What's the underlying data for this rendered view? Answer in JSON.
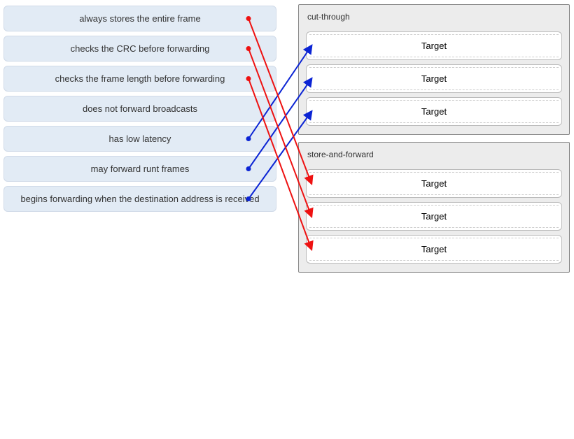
{
  "sources": [
    {
      "id": "src0",
      "label": "always stores the entire frame"
    },
    {
      "id": "src1",
      "label": "checks the CRC before forwarding"
    },
    {
      "id": "src2",
      "label": "checks the frame length before forwarding"
    },
    {
      "id": "src3",
      "label": "does not forward broadcasts"
    },
    {
      "id": "src4",
      "label": "has low latency"
    },
    {
      "id": "src5",
      "label": "may forward runt frames"
    },
    {
      "id": "src6",
      "label": "begins forwarding when the destination address is received"
    }
  ],
  "groups": [
    {
      "id": "grp0",
      "title": "cut-through",
      "targets": [
        {
          "id": "t0",
          "label": "Target"
        },
        {
          "id": "t1",
          "label": "Target"
        },
        {
          "id": "t2",
          "label": "Target"
        }
      ]
    },
    {
      "id": "grp1",
      "title": "store-and-forward",
      "targets": [
        {
          "id": "t3",
          "label": "Target"
        },
        {
          "id": "t4",
          "label": "Target"
        },
        {
          "id": "t5",
          "label": "Target"
        }
      ]
    }
  ],
  "connections": [
    {
      "from": "src4",
      "to": "t0",
      "color": "#0b24d4"
    },
    {
      "from": "src5",
      "to": "t1",
      "color": "#0b24d4"
    },
    {
      "from": "src6",
      "to": "t2",
      "color": "#0b24d4"
    },
    {
      "from": "src0",
      "to": "t3",
      "color": "#e11"
    },
    {
      "from": "src1",
      "to": "t4",
      "color": "#e11"
    },
    {
      "from": "src2",
      "to": "t5",
      "color": "#e11"
    }
  ]
}
